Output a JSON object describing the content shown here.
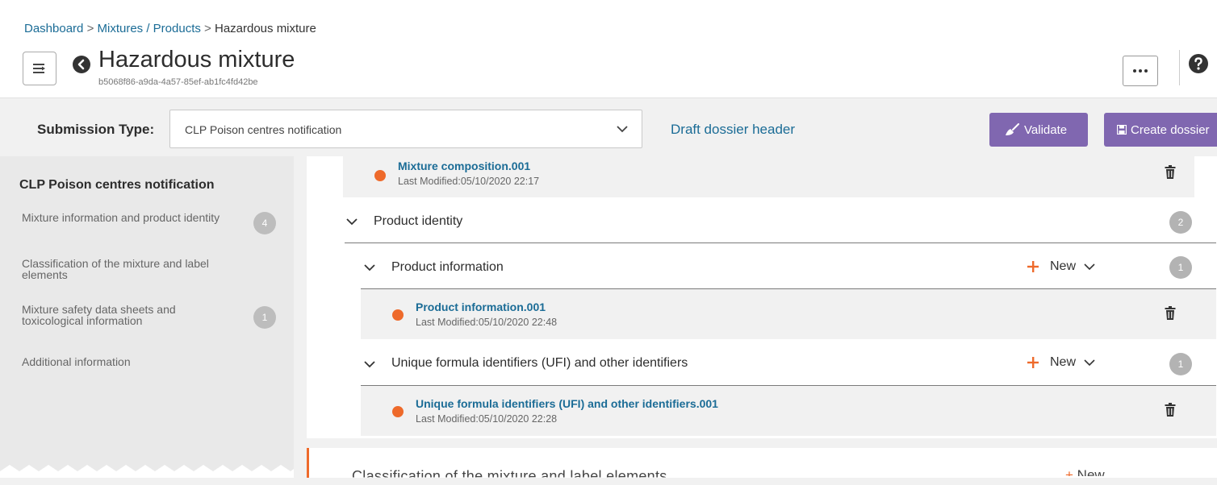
{
  "breadcrumb": {
    "dashboard": "Dashboard",
    "mixtures": "Mixtures / Products",
    "separator": ">",
    "current": "Hazardous mixture"
  },
  "header": {
    "title": "Hazardous mixture",
    "uuid": "b5068f86-a9da-4a57-85ef-ab1fc4fd42be"
  },
  "toolbar": {
    "submission_label": "Submission Type:",
    "submission_value": "CLP Poison centres notification",
    "draft_link": "Draft dossier header",
    "validate_label": "Validate",
    "create_label": "Create dossier"
  },
  "sidebar": {
    "title": "CLP Poison centres notification",
    "items": [
      {
        "label": "Mixture information and product identity",
        "count": "4"
      },
      {
        "label": "Classification of the mixture and label elements",
        "count": ""
      },
      {
        "label": "Mixture safety data sheets and toxicological information",
        "count": "1"
      },
      {
        "label": "Additional information",
        "count": ""
      }
    ]
  },
  "main": {
    "composition_entry": {
      "title": "Mixture composition.001",
      "meta": "Last Modified:05/10/2020 22:17"
    },
    "product_identity": {
      "label": "Product identity",
      "count": "2"
    },
    "product_information": {
      "label": "Product information",
      "new_label": "New",
      "count": "1",
      "entry": {
        "title": "Product information.001",
        "meta": "Last Modified:05/10/2020 22:48"
      }
    },
    "ufi": {
      "label": "Unique formula identifiers (UFI) and other identifiers",
      "new_label": "New",
      "count": "1",
      "entry": {
        "title": "Unique formula identifiers (UFI) and other identifiers.001",
        "meta": "Last Modified:05/10/2020 22:28"
      }
    },
    "next_section": {
      "label": "Classification of the mixture and label elements",
      "new_label": "New"
    }
  },
  "colors": {
    "accent_blue": "#1b6c96",
    "accent_orange": "#ee6a2b",
    "button_purple": "#8067b0",
    "badge_grey": "#b3b3b3"
  },
  "icons": [
    "menu-icon",
    "back-icon",
    "more-icon",
    "help-icon",
    "chevron-down-icon",
    "broom-icon",
    "save-icon",
    "trash-icon",
    "plus-icon"
  ]
}
